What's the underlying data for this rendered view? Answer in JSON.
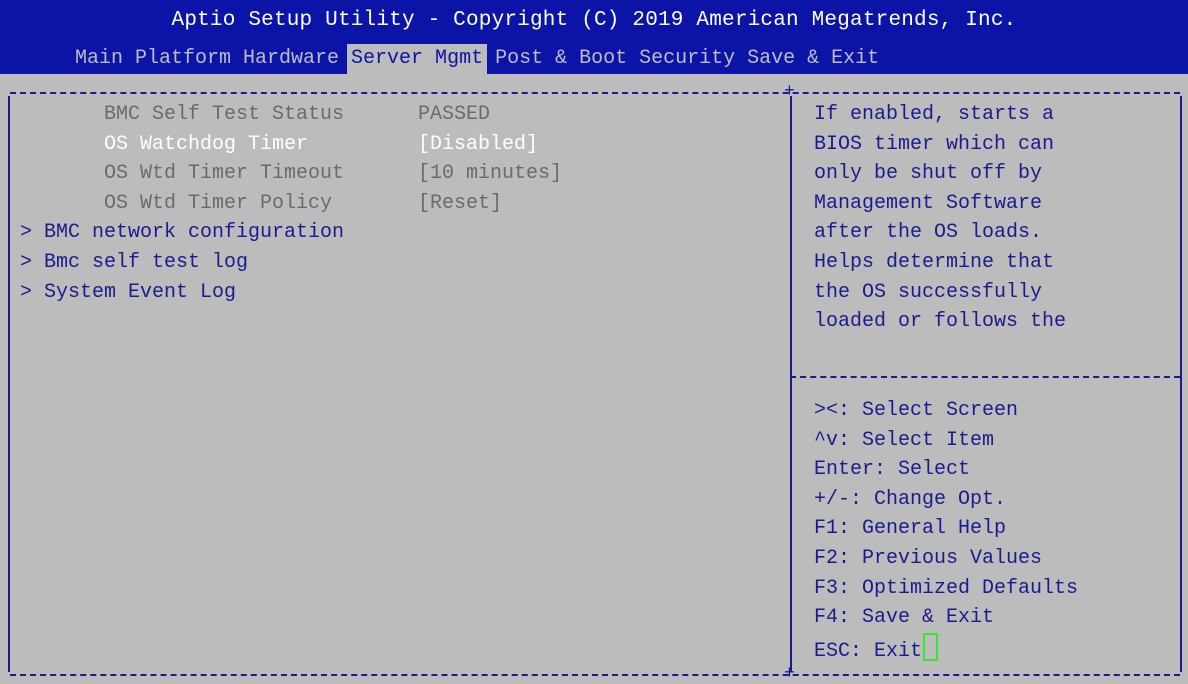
{
  "header": {
    "title": "Aptio Setup Utility - Copyright (C) 2019 American Megatrends, Inc.",
    "tabs": [
      {
        "label": "Main"
      },
      {
        "label": "Platform"
      },
      {
        "label": "Hardware"
      },
      {
        "label": "Server Mgmt"
      },
      {
        "label": "Post & Boot"
      },
      {
        "label": "Security"
      },
      {
        "label": "Save & Exit"
      }
    ],
    "active_tab": "Server Mgmt"
  },
  "settings": [
    {
      "label": "BMC Self Test Status",
      "value": "PASSED"
    },
    {
      "label": "OS Watchdog Timer",
      "value": "[Disabled]"
    },
    {
      "label": "OS Wtd Timer Timeout",
      "value": "[10 minutes]"
    },
    {
      "label": "OS Wtd Timer Policy",
      "value": "[Reset]"
    }
  ],
  "submenus": [
    {
      "label": "> BMC network configuration"
    },
    {
      "label": "> Bmc self test log"
    },
    {
      "label": "> System Event Log"
    }
  ],
  "help_text": [
    "If enabled, starts a",
    "BIOS timer which can",
    "only be shut off by",
    "Management Software",
    "after the OS loads.",
    "Helps determine that",
    "the OS successfully",
    "loaded or follows the"
  ],
  "key_help": [
    "><: Select Screen",
    "^v: Select Item",
    "Enter: Select",
    "+/-: Change Opt.",
    "F1: General Help",
    "F2: Previous Values",
    "F3: Optimized Defaults",
    "F4: Save & Exit",
    "ESC: Exit"
  ],
  "colors": {
    "header_bg": "#0c14a8",
    "body_bg": "#bcbcbc",
    "text_blue": "#1a1c8e",
    "text_gray": "#6b6b6b",
    "text_selected": "#ffffff",
    "cursor_green": "#36e536"
  }
}
